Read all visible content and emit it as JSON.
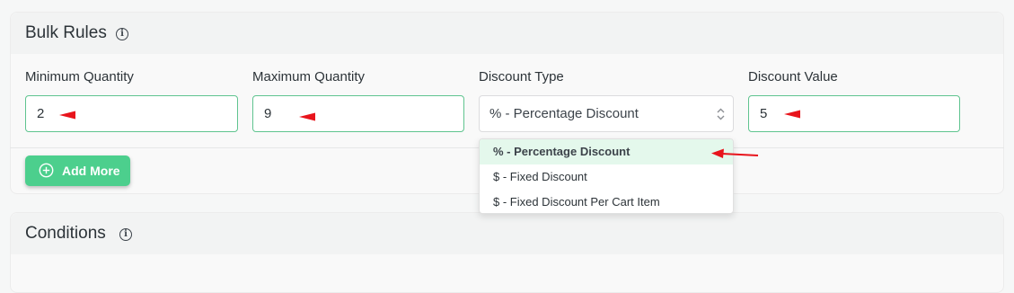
{
  "bulk_rules": {
    "title": "Bulk Rules",
    "info_icon": "info-icon",
    "fields": {
      "min_qty": {
        "label": "Minimum Quantity",
        "value": "2"
      },
      "max_qty": {
        "label": "Maximum Quantity",
        "value": "9"
      },
      "discount_type": {
        "label": "Discount Type",
        "value": "% - Percentage Discount"
      },
      "discount_value": {
        "label": "Discount Value",
        "value": "5"
      }
    },
    "add_more_label": "Add More",
    "dropdown_options": [
      "% - Percentage Discount",
      "$ - Fixed Discount",
      "$ - Fixed Discount Per Cart Item"
    ]
  },
  "conditions": {
    "title": "Conditions",
    "info_icon": "info-icon"
  },
  "colors": {
    "accent_green": "#4ccf8d",
    "input_border_green": "#5fc48f",
    "selected_option_bg": "#e4f8ec",
    "annotation_red": "#e8141c"
  }
}
